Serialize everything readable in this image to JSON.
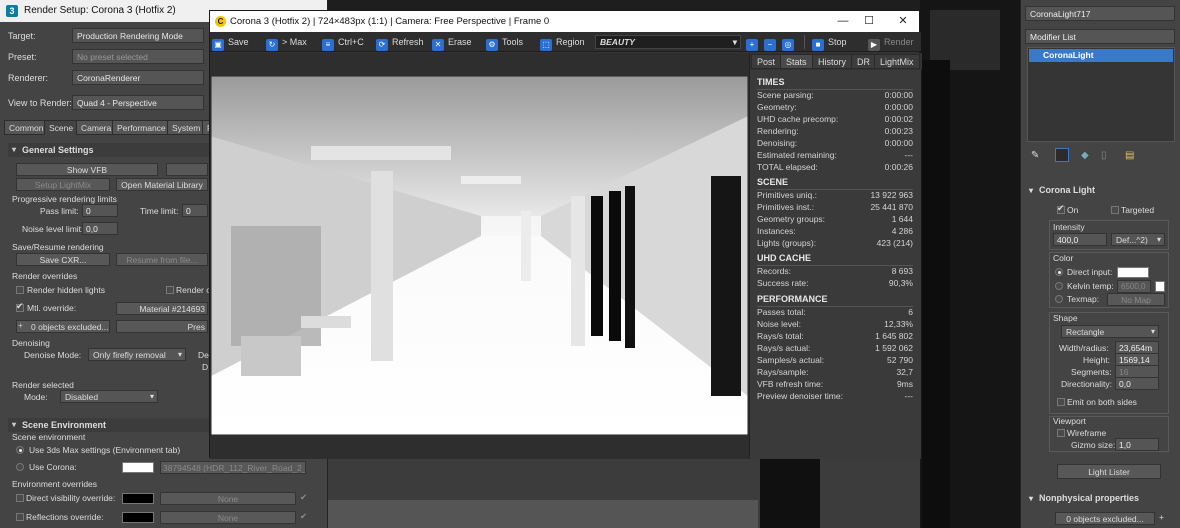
{
  "render_setup": {
    "title": "Render Setup: Corona 3 (Hotfix 2)",
    "target_label": "Target:",
    "target_value": "Production Rendering Mode",
    "preset_label": "Preset:",
    "preset_value": "No preset selected",
    "renderer_label": "Renderer:",
    "renderer_value": "CoronaRenderer",
    "view_label": "View to Render:",
    "view_value": "Quad 4 - Perspective",
    "tabs": [
      "Common",
      "Scene",
      "Camera",
      "Performance",
      "System",
      "F"
    ],
    "general_settings": "General Settings",
    "show_vfb": "Show VFB",
    "setup_lightmix": "Setup LightMix",
    "open_material_library": "Open Material Library",
    "progressive_limits": "Progressive rendering limits",
    "pass_limit_label": "Pass limit:",
    "pass_limit_value": "0",
    "time_limit_label": "Time limit:",
    "time_limit_value": "0",
    "noise_limit_label": "Noise level limit:",
    "noise_limit_value": "0,0",
    "save_resume": "Save/Resume rendering",
    "save_cxr": "Save CXR...",
    "resume_from_file": "Resume from file...",
    "render_overrides": "Render overrides",
    "render_hidden_lights": "Render hidden lights",
    "render_o": "Render o",
    "mtl_override": "Mtl. override:",
    "mtl_override_value": "Material #214693",
    "objects_excluded": "0 objects excluded...",
    "pres": "Pres",
    "denoising": "Denoising",
    "denoise_mode_label": "Denoise Mode:",
    "denoise_mode_value": "Only firefly removal",
    "de": "De",
    "d": "D",
    "render_selected": "Render selected",
    "mode_label": "Mode:",
    "mode_value": "Disabled",
    "scene_environment": "Scene Environment",
    "scene_environment_sub": "Scene environment",
    "use_3dsmax": "Use 3ds Max settings (Environment tab)",
    "use_corona": "Use Corona:",
    "hdr_map": "38794548 (HDR_112_River_Road_2_E",
    "env_overrides": "Environment overrides",
    "direct_visibility": "Direct visibility override:",
    "reflections_override": "Reflections override:",
    "none_1": "None",
    "none_2": "None"
  },
  "vfb": {
    "title": "Corona 3 (Hotfix 2) | 724×483px (1:1) | Camera: Free Perspective | Frame 0",
    "toolbar": {
      "save": "Save",
      "max": "> Max",
      "ctrl_c": "Ctrl+C",
      "refresh": "Refresh",
      "erase": "Erase",
      "tools": "Tools",
      "region": "Region",
      "channel": "BEAUTY",
      "stop": "Stop",
      "render": "Render"
    },
    "side_tabs": [
      "Post",
      "Stats",
      "History",
      "DR",
      "LightMix"
    ],
    "times": {
      "title": "TIMES",
      "rows": [
        {
          "k": "Scene parsing:",
          "v": "0:00:00"
        },
        {
          "k": "Geometry:",
          "v": "0:00:00"
        },
        {
          "k": "UHD cache precomp:",
          "v": "0:00:02"
        },
        {
          "k": "Rendering:",
          "v": "0:00:23"
        },
        {
          "k": "Denoising:",
          "v": "0:00:00"
        },
        {
          "k": "Estimated remaining:",
          "v": "---"
        },
        {
          "k": "TOTAL elapsed:",
          "v": "0:00:26"
        }
      ]
    },
    "scene": {
      "title": "SCENE",
      "rows": [
        {
          "k": "Primitives uniq.:",
          "v": "13 922 963"
        },
        {
          "k": "Primitives inst.:",
          "v": "25 441 870"
        },
        {
          "k": "Geometry groups:",
          "v": "1 644"
        },
        {
          "k": "Instances:",
          "v": "4 286"
        },
        {
          "k": "Lights (groups):",
          "v": "423 (214)"
        }
      ]
    },
    "uhd": {
      "title": "UHD CACHE",
      "rows": [
        {
          "k": "Records:",
          "v": "8 693"
        },
        {
          "k": "Success rate:",
          "v": "90,3%"
        }
      ]
    },
    "performance": {
      "title": "PERFORMANCE",
      "rows": [
        {
          "k": "Passes total:",
          "v": "6"
        },
        {
          "k": "Noise level:",
          "v": "12,33%"
        },
        {
          "k": "Rays/s total:",
          "v": "1 645 802"
        },
        {
          "k": "Rays/s actual:",
          "v": "1 592 062"
        },
        {
          "k": "Samples/s actual:",
          "v": "52 790"
        },
        {
          "k": "Rays/sample:",
          "v": "32,7"
        },
        {
          "k": "VFB refresh time:",
          "v": "9ms"
        },
        {
          "k": "Preview denoiser time:",
          "v": "---"
        }
      ]
    }
  },
  "modifier": {
    "object_name": "CoronaLight717",
    "modifier_list": "Modifier List",
    "stack_item": "CoronaLight",
    "corona_light": "Corona Light",
    "on": "On",
    "targeted": "Targeted",
    "intensity_label": "Intensity",
    "intensity_value": "400,0",
    "intensity_unit": "Def...^2)",
    "color_label": "Color",
    "direct_input": "Direct input:",
    "kelvin_temp": "Kelvin temp:",
    "kelvin_value": "6500,0",
    "texmap": "Texmap:",
    "no_map": "No Map",
    "shape_label": "Shape",
    "shape_value": "Rectangle",
    "width_label": "Width/radius:",
    "width_value": "23,654m",
    "height_label": "Height:",
    "height_value": "1569,14",
    "segments_label": "Segments:",
    "segments_value": "16",
    "directionality_label": "Directionality:",
    "directionality_value": "0,0",
    "emit_both": "Emit on both sides",
    "viewport_label": "Viewport",
    "wireframe": "Wireframe",
    "gizmo_label": "Gizmo size:",
    "gizmo_value": "1,0",
    "light_lister": "Light Lister",
    "nonphysical": "Nonphysical properties",
    "objects_excluded": "0 objects excluded..."
  },
  "colors": {
    "accent_blue": "#2a6fd6",
    "stack_selected": "#3a78c8",
    "corona_yellow": "#f4c400"
  }
}
